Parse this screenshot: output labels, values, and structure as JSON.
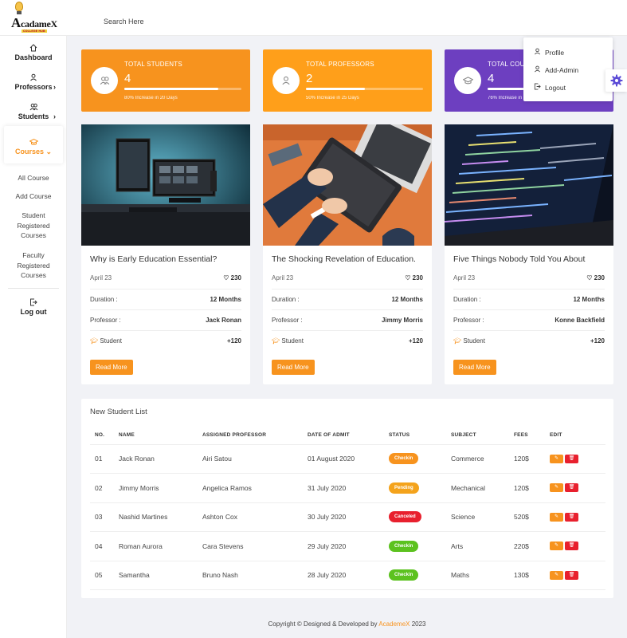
{
  "brand": {
    "name_big": "A",
    "name_rest": "cadameX",
    "tagline": "COLLEGE HUB"
  },
  "search": {
    "placeholder": "Search Here"
  },
  "sidebar": {
    "items": [
      {
        "label": "Dashboard",
        "icon": "home-icon"
      },
      {
        "label": "Professors",
        "icon": "user-icon",
        "arrow": "›"
      },
      {
        "label": "Students",
        "icon": "users-icon",
        "arrow": "›"
      },
      {
        "label": "Courses",
        "icon": "graduation-cap-icon",
        "arrow": "⌄"
      }
    ],
    "sub_items": [
      "All Course",
      "Add Course",
      "Student Registered Courses",
      "Faculty Registered Courses"
    ],
    "logout": {
      "label": "Log out",
      "icon": "logout-icon"
    }
  },
  "stats": [
    {
      "label": "TOTAL STUDENTS",
      "value": "4",
      "progress": 0.8,
      "note": "80% Increase in 20 Days",
      "color": "#f7931e",
      "icon": "users-icon"
    },
    {
      "label": "TOTAL PROFESSORS",
      "value": "2",
      "progress": 0.5,
      "note": "50% Increase in 25 Days",
      "color": "#ff9f1a",
      "icon": "user-icon"
    },
    {
      "label": "TOTAL COURSES",
      "value": "4",
      "progress": 0.76,
      "note": "76% Increase in 20 Days",
      "color": "#6d3fc0",
      "icon": "graduation-cap-icon"
    }
  ],
  "courses": [
    {
      "title": "Why is Early Education Essential?",
      "date": "April 23",
      "likes": "230",
      "duration_label": "Duration :",
      "duration": "12 Months",
      "professor_label": "Professor :",
      "professor": "Jack Ronan",
      "student_label": "Student",
      "students": "+120",
      "button": "Read More"
    },
    {
      "title": "The Shocking Revelation of Education.",
      "date": "April 23",
      "likes": "230",
      "duration_label": "Duration :",
      "duration": "12 Months",
      "professor_label": "Professor :",
      "professor": "Jimmy Morris",
      "student_label": "Student",
      "students": "+120",
      "button": "Read More"
    },
    {
      "title": "Five Things Nobody Told You About",
      "date": "April 23",
      "likes": "230",
      "duration_label": "Duration :",
      "duration": "12 Months",
      "professor_label": "Professor :",
      "professor": "Konne Backfield",
      "student_label": "Student",
      "students": "+120",
      "button": "Read More"
    }
  ],
  "table": {
    "title": "New Student List",
    "headers": [
      "NO.",
      "NAME",
      "ASSIGNED PROFESSOR",
      "DATE OF ADMIT",
      "STATUS",
      "SUBJECT",
      "FEES",
      "EDIT"
    ],
    "rows": [
      {
        "no": "01",
        "name": "Jack Ronan",
        "professor": "Airi Satou",
        "date": "01 August 2020",
        "status": "Checkin",
        "status_color": "#f7931e",
        "subject": "Commerce",
        "fees": "120$"
      },
      {
        "no": "02",
        "name": "Jimmy Morris",
        "professor": "Angelica Ramos",
        "date": "31 July 2020",
        "status": "Pending",
        "status_color": "#f4a31c",
        "subject": "Mechanical",
        "fees": "120$"
      },
      {
        "no": "03",
        "name": "Nashid Martines",
        "professor": "Ashton Cox",
        "date": "30 July 2020",
        "status": "Canceled",
        "status_color": "#e8202e",
        "subject": "Science",
        "fees": "520$"
      },
      {
        "no": "04",
        "name": "Roman Aurora",
        "professor": "Cara Stevens",
        "date": "29 July 2020",
        "status": "Checkin",
        "status_color": "#5cc21f",
        "subject": "Arts",
        "fees": "220$"
      },
      {
        "no": "05",
        "name": "Samantha",
        "professor": "Bruno Nash",
        "date": "28 July 2020",
        "status": "Checkin",
        "status_color": "#5cc21f",
        "subject": "Maths",
        "fees": "130$"
      }
    ]
  },
  "footer": {
    "text": "Copyright © Designed & Developed by ",
    "link": "AcademeX",
    "year": " 2023"
  },
  "dropdown": {
    "items": [
      {
        "label": "Profile",
        "icon": "user-icon"
      },
      {
        "label": "Add-Admin",
        "icon": "user-icon"
      },
      {
        "label": "Logout",
        "icon": "logout-icon"
      }
    ]
  },
  "colors": {
    "accent": "#f7931e",
    "purple": "#6d3fc0",
    "delete": "#e8202e"
  }
}
